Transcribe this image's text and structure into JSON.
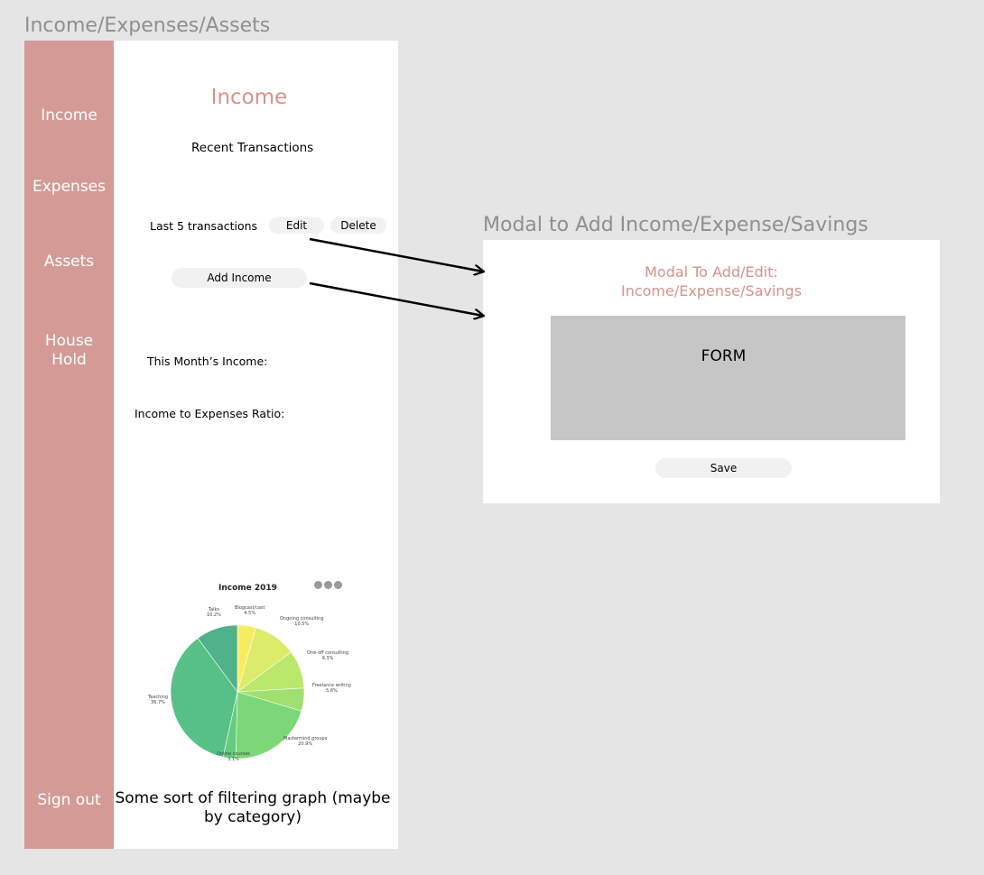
{
  "frames": {
    "main_title": "Income/Expenses/Assets",
    "modal_title": "Modal to Add Income/Expense/Savings"
  },
  "sidebar": {
    "items": [
      {
        "label": "Income"
      },
      {
        "label": "Expenses"
      },
      {
        "label": "Assets"
      },
      {
        "label": "House\nHold"
      },
      {
        "label": "Sign out"
      }
    ]
  },
  "main": {
    "title": "Income",
    "recent_transactions": "Recent Transactions",
    "last_transactions": "Last 5 transactions",
    "edit_label": "Edit",
    "delete_label": "Delete",
    "add_income_label": "Add Income",
    "month_income": "This Month’s Income:",
    "ratio": "Income to Expenses Ratio:",
    "caption": "Some sort of filtering graph (maybe by category)"
  },
  "modal": {
    "title_line1": "Modal To Add/Edit:",
    "title_line2": "Income/Expense/Savings",
    "form_label": "FORM",
    "save_label": "Save"
  },
  "chart_data": {
    "type": "pie",
    "title": "Income 2019",
    "slices": [
      {
        "name": "Blogcast/cast",
        "value": 4.5,
        "color": "#f7ec5f"
      },
      {
        "name": "Ongoing consulting",
        "value": 10.5,
        "color": "#dcec6a"
      },
      {
        "name": "One-off consulting",
        "value": 9.3,
        "color": "#b9e86a"
      },
      {
        "name": "Freelance writing",
        "value": 5.6,
        "color": "#9fe06e"
      },
      {
        "name": "Mastermind groups",
        "value": 20.9,
        "color": "#7bd777"
      },
      {
        "name": "Online courses",
        "value": 3.1,
        "color": "#64cc7e"
      },
      {
        "name": "Teaching",
        "value": 36.7,
        "color": "#56c087"
      },
      {
        "name": "Talks",
        "value": 10.2,
        "color": "#4fb28a"
      }
    ],
    "labels": [
      {
        "name": "Blogcast/cast",
        "pct": "4.5%"
      },
      {
        "name": "Ongoing consulting",
        "pct": "10.5%"
      },
      {
        "name": "One-off consulting",
        "pct": "9.3%"
      },
      {
        "name": "Freelance writing",
        "pct": "5.6%"
      },
      {
        "name": "Mastermind groups",
        "pct": "20.9%"
      },
      {
        "name": "Online courses",
        "pct": "3.1%"
      },
      {
        "name": "Teaching",
        "pct": "36.7%"
      },
      {
        "name": "Talks",
        "pct": "10.2%"
      }
    ]
  }
}
